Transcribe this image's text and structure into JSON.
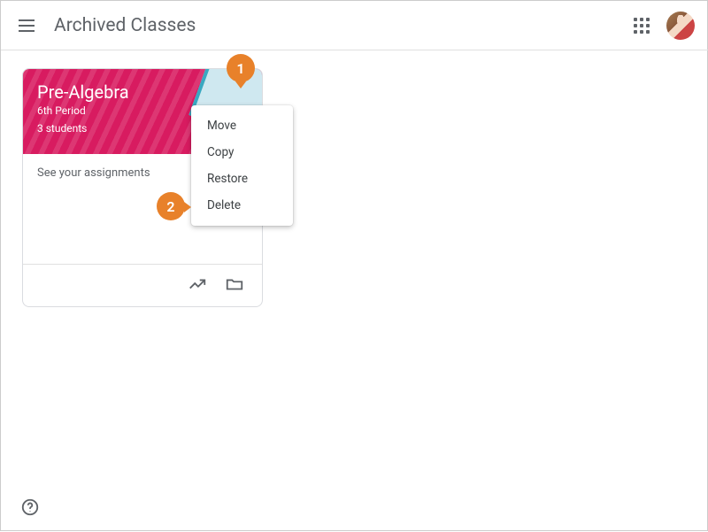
{
  "header": {
    "title": "Archived Classes"
  },
  "card": {
    "title": "Pre-Algebra",
    "section": "6th Period",
    "students": "3 students",
    "body_link": "See your assignments"
  },
  "menu": {
    "items": [
      "Move",
      "Copy",
      "Restore",
      "Delete"
    ]
  },
  "callouts": {
    "one": "1",
    "two": "2"
  }
}
